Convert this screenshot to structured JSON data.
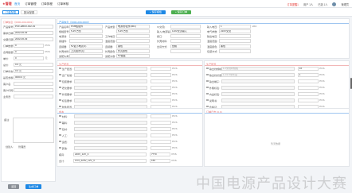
{
  "app": {
    "brand": "★管理",
    "nav": [
      "首页",
      "订单管理",
      "订单排程",
      "订单审核"
    ],
    "notice": "订单提醒1",
    "user_count": "用户 1人",
    "member": "已选 1人",
    "user_name": "管理员"
  },
  "tabs": [
    "订单配置",
    "配对配置"
  ],
  "actions": {
    "save": "+ 保存模板",
    "submit": "+ 保存订单"
  },
  "left": {
    "title": "订单信息（0000-200-0001）",
    "fields": [
      {
        "label": "产品编号:",
        "value": "PCF-EBC0-012-01",
        "unit": ""
      },
      {
        "label": "需求日期:",
        "value": "2022-06-03",
        "unit": ""
      },
      {
        "label": "交期日期:",
        "value": "2022-06-03",
        "unit": ""
      },
      {
        "label": "订单数量:",
        "value": "0",
        "unit": "PCS"
      },
      {
        "label": "合同数量:",
        "value": "0",
        "unit": "PCS"
      },
      {
        "label": "单价:",
        "value": "0",
        "unit": "元"
      },
      {
        "label": "总价:",
        "value": "0.0 元",
        "unit": ""
      },
      {
        "label": "订单状态:",
        "value": "0.0 元",
        "unit": ""
      },
      {
        "label": "是否含税:",
        "value": "0000.0 元",
        "unit": ""
      },
      {
        "label": "客户名:",
        "value": "",
        "unit": ""
      },
      {
        "label": "客户代码:",
        "value": "",
        "unit": ""
      },
      {
        "label": "业务员:",
        "value": "",
        "unit": ""
      }
    ],
    "remark_label": "备注:",
    "creator_label": "创建人:",
    "creator": "管理员"
  },
  "product": {
    "title": "产品信息（0000-200-0000）",
    "rows": [
      {
        "label": "产品名称:",
        "value": "PCB板组件",
        "label2": "产品类型:",
        "value2": "电源线/配件(001)"
      },
      {
        "label": "规格型号:",
        "value": "5-25 方形",
        "label2": "",
        "value2": "5-25 方形"
      },
      {
        "label": "电源线:",
        "value": "",
        "label2": "工作电压:",
        "value2": ""
      },
      {
        "label": "接插件:",
        "value": "",
        "label2": "温度范围:",
        "value2": ""
      },
      {
        "label": "连接器:",
        "value": "5V最小电流(1)",
        "label2": "连接器:",
        "value2": "黑色"
      },
      {
        "label": "外壳材料:",
        "value": "上壳组(外壳)",
        "label2": "外壳颜色:",
        "value2": "外壳颜色"
      },
      {
        "label": "适配头类型:",
        "value": "",
        "label2": "适配头数:",
        "value2": "5V插座"
      }
    ],
    "right_rows": [
      {
        "label": "输入电压:",
        "value": "1",
        "unit": "VAC"
      },
      {
        "label": "电气参数:",
        "value": "220V交流",
        "unit": ""
      },
      {
        "label": "输出电压:",
        "value": "",
        "unit": ""
      },
      {
        "label": "温度范围:",
        "value": "",
        "unit": ""
      },
      {
        "label": "温度颜色:",
        "value": "黑色",
        "unit": ""
      },
      {
        "label": "包装方式:",
        "value": "",
        "unit": ""
      }
    ],
    "right_extra": [
      {
        "label": "V(交流)",
        "value": ""
      },
      {
        "label": "输入(电源输入):",
        "value": "110V交流输入"
      },
      {
        "label": "接口:",
        "value": ""
      },
      {
        "label": "外壳材料:",
        "value": ""
      },
      {
        "label": "出货方式:",
        "value": "纸箱"
      },
      {
        "label": "",
        "value": ""
      }
    ]
  },
  "parts_left": {
    "title": "生产配置",
    "rows": [
      {
        "label": "生产配置:",
        "value": "",
        "qty": "",
        "unit": "PCS"
      },
      {
        "label": "出厂检验:",
        "value": "",
        "qty": "",
        "unit": "PCS"
      },
      {
        "label": "包装要求:",
        "value": "",
        "qty": "",
        "unit": "PCS"
      },
      {
        "label": "老化要求:",
        "value": "",
        "qty": "",
        "unit": "PCS"
      },
      {
        "label": "外观要求:",
        "value": "",
        "qty": "",
        "unit": "PCS"
      },
      {
        "label": "标签要求:",
        "value": "",
        "qty": "",
        "unit": "PCS"
      },
      {
        "label": "附件配置:",
        "value": "",
        "qty": "",
        "unit": "PCS"
      }
    ]
  },
  "parts_right": {
    "title": "生产配置",
    "rows": [
      {
        "label": "输出线规格:",
        "value": "1.2米线材规格",
        "qty": "10",
        "unit": "PCS"
      },
      {
        "label": "输出线长度:",
        "value": "1.2/1.5米长度",
        "qty": "1",
        "unit": "PCS"
      },
      {
        "label": "输出端子:",
        "value": "",
        "qty": "",
        "unit": "PCS"
      },
      {
        "label": "外箱标签:",
        "value": "",
        "qty": "",
        "unit": "PCS"
      },
      {
        "label": "内盒标签:",
        "value": "",
        "qty": "",
        "unit": "PCS"
      },
      {
        "label": "说明书:",
        "value": "",
        "qty": "",
        "unit": "PCS"
      },
      {
        "label": "合格证:",
        "value": "",
        "qty": "",
        "unit": "PCS"
      }
    ]
  },
  "cost": {
    "title": "成本",
    "rows": [
      {
        "label": "材料:",
        "value": "",
        "qty": "",
        "unit": "PCS"
      },
      {
        "label": "辅料:",
        "value": "",
        "qty": "",
        "unit": "PCS"
      },
      {
        "label": "包材:",
        "value": "",
        "qty": "",
        "unit": "PCS"
      },
      {
        "label": "人工:",
        "value": "",
        "qty": "",
        "unit": "PCS"
      },
      {
        "label": "运费:",
        "value": "",
        "qty": "",
        "unit": "PCS"
      },
      {
        "label": "其他:",
        "value": "",
        "qty": "",
        "unit": "PCS"
      }
    ],
    "extra": [
      {
        "label": "模具:",
        "value": "220V_12V_3",
        "qty": "7770",
        "unit": "PCS"
      },
      {
        "label": "合计:",
        "value": "CV3_220V_12V_3",
        "qty": "160",
        "unit": "PCS"
      }
    ]
  },
  "log": {
    "title": "订单日志 (0.0)",
    "empty": "暂无数据"
  },
  "bottom": {
    "back": "返回",
    "confirm": "生成订单"
  },
  "watermark": "中国电源产品设计大赛",
  "colors": {
    "accent": "#1e88e5",
    "green": "#4caf50",
    "red": "#e53935",
    "grey_btn": "#8a8f96"
  }
}
